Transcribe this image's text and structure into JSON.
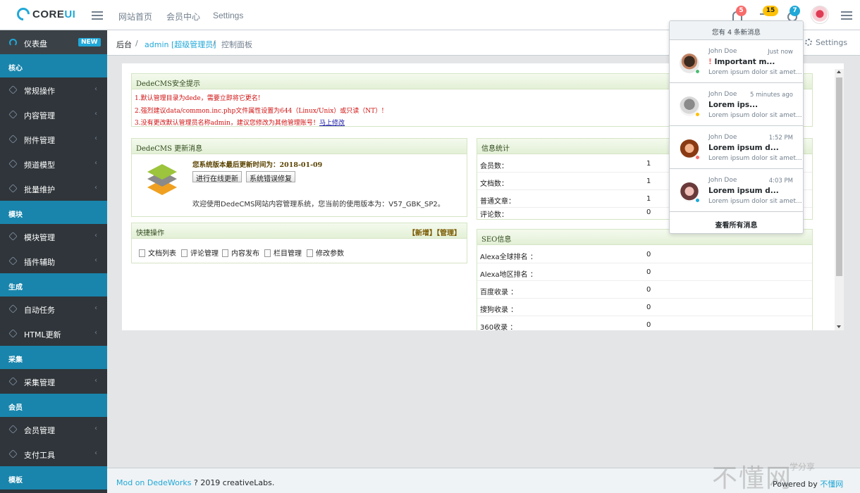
{
  "header": {
    "logo_text_main": "CORE",
    "logo_text_accent": "UI",
    "nav": [
      "网站首页",
      "会员中心",
      "Settings"
    ],
    "badges": {
      "notifications": "5",
      "tasks": "15",
      "messages": "7"
    },
    "colors": {
      "accent": "#20a8d8",
      "danger": "#f86c6b",
      "warning": "#ffc107"
    }
  },
  "sidebar": {
    "dashboard": {
      "label": "仪表盘",
      "badge": "NEW"
    },
    "chevron": "‹",
    "sections": [
      {
        "title": "核心",
        "items": [
          "常规操作",
          "内容管理",
          "附件管理",
          "频道模型",
          "批量维护"
        ]
      },
      {
        "title": "模块",
        "items": [
          "模块管理",
          "插件辅助"
        ]
      },
      {
        "title": "生成",
        "items": [
          "自动任务",
          "HTML更新"
        ]
      },
      {
        "title": "采集",
        "items": [
          "采集管理"
        ]
      },
      {
        "title": "会员",
        "items": [
          "会员管理",
          "支付工具"
        ]
      },
      {
        "title": "模板",
        "items": []
      }
    ]
  },
  "breadcrumb": {
    "items": [
      "后台",
      "admin [超级管理员]",
      "控制面板"
    ],
    "separator": "/",
    "settings": "Settings"
  },
  "security": {
    "title": "DedeCMS安全提示",
    "warnings": [
      "1.默认管理目录为dede，需要立即将它更名!",
      "2.强烈建议data/common.inc.php文件属性设置为644（Linux/Unix）或只读（NT）!",
      "3.没有更改默认管理员名称admin，建议您修改为其他管理账号！"
    ],
    "fix_link": "马上修改"
  },
  "update": {
    "title": "DedeCMS 更新消息",
    "last_update": "您系统版本最后更新时间为：2018-01-09",
    "btn_online": "进行在线更新",
    "btn_repair": "系统错误修复",
    "welcome": "欢迎使用DedeCMS网站内容管理系统，您当前的使用版本为：V57_GBK_SP2。"
  },
  "quick": {
    "title": "快捷操作",
    "actions": "【新增】【管理】",
    "links": [
      "文档列表",
      "评论管理",
      "内容发布",
      "栏目管理",
      "修改参数"
    ]
  },
  "stats": {
    "title": "信息统计",
    "rows": [
      {
        "label": "会员数：",
        "value": "1"
      },
      {
        "label": "文档数：",
        "value": "1"
      },
      {
        "label": "普通文章：",
        "value": "1"
      },
      {
        "label": "评论数：",
        "value": "0"
      }
    ]
  },
  "seo": {
    "title": "SEO信息",
    "rows": [
      {
        "label": "Alexa全球排名 ：",
        "value": "0"
      },
      {
        "label": "Alexa地区排名 ：",
        "value": "0"
      },
      {
        "label": "百度收录 ：",
        "value": "0"
      },
      {
        "label": "搜狗收录 ：",
        "value": "0"
      },
      {
        "label": "360收录 ：",
        "value": "0"
      }
    ]
  },
  "notifications": {
    "header": "您有 4 条新消息",
    "messages": [
      {
        "from": "John Doe",
        "time": "Just now",
        "urgent": "!",
        "subject": "Important m...",
        "body": "Lorem ipsum dolor sit amet..."
      },
      {
        "from": "John Doe",
        "time": "5 minutes ago",
        "subject": "Lorem ips...",
        "body": "Lorem ipsum dolor sit amet..."
      },
      {
        "from": "John Doe",
        "time": "1:52 PM",
        "subject": "Lorem ipsum d...",
        "body": "Lorem ipsum dolor sit amet..."
      },
      {
        "from": "John Doe",
        "time": "4:03 PM",
        "subject": "Lorem ipsum d...",
        "body": "Lorem ipsum dolor sit amet..."
      }
    ],
    "footer": "查看所有消息"
  },
  "footer": {
    "link": "Mod on DedeWorks",
    "rest": " ? 2019 creativeLabs.",
    "powered": "Powered by",
    "powered_link": "不懂网",
    "watermark": "不懂网",
    "watermark_sub": "学分享"
  }
}
